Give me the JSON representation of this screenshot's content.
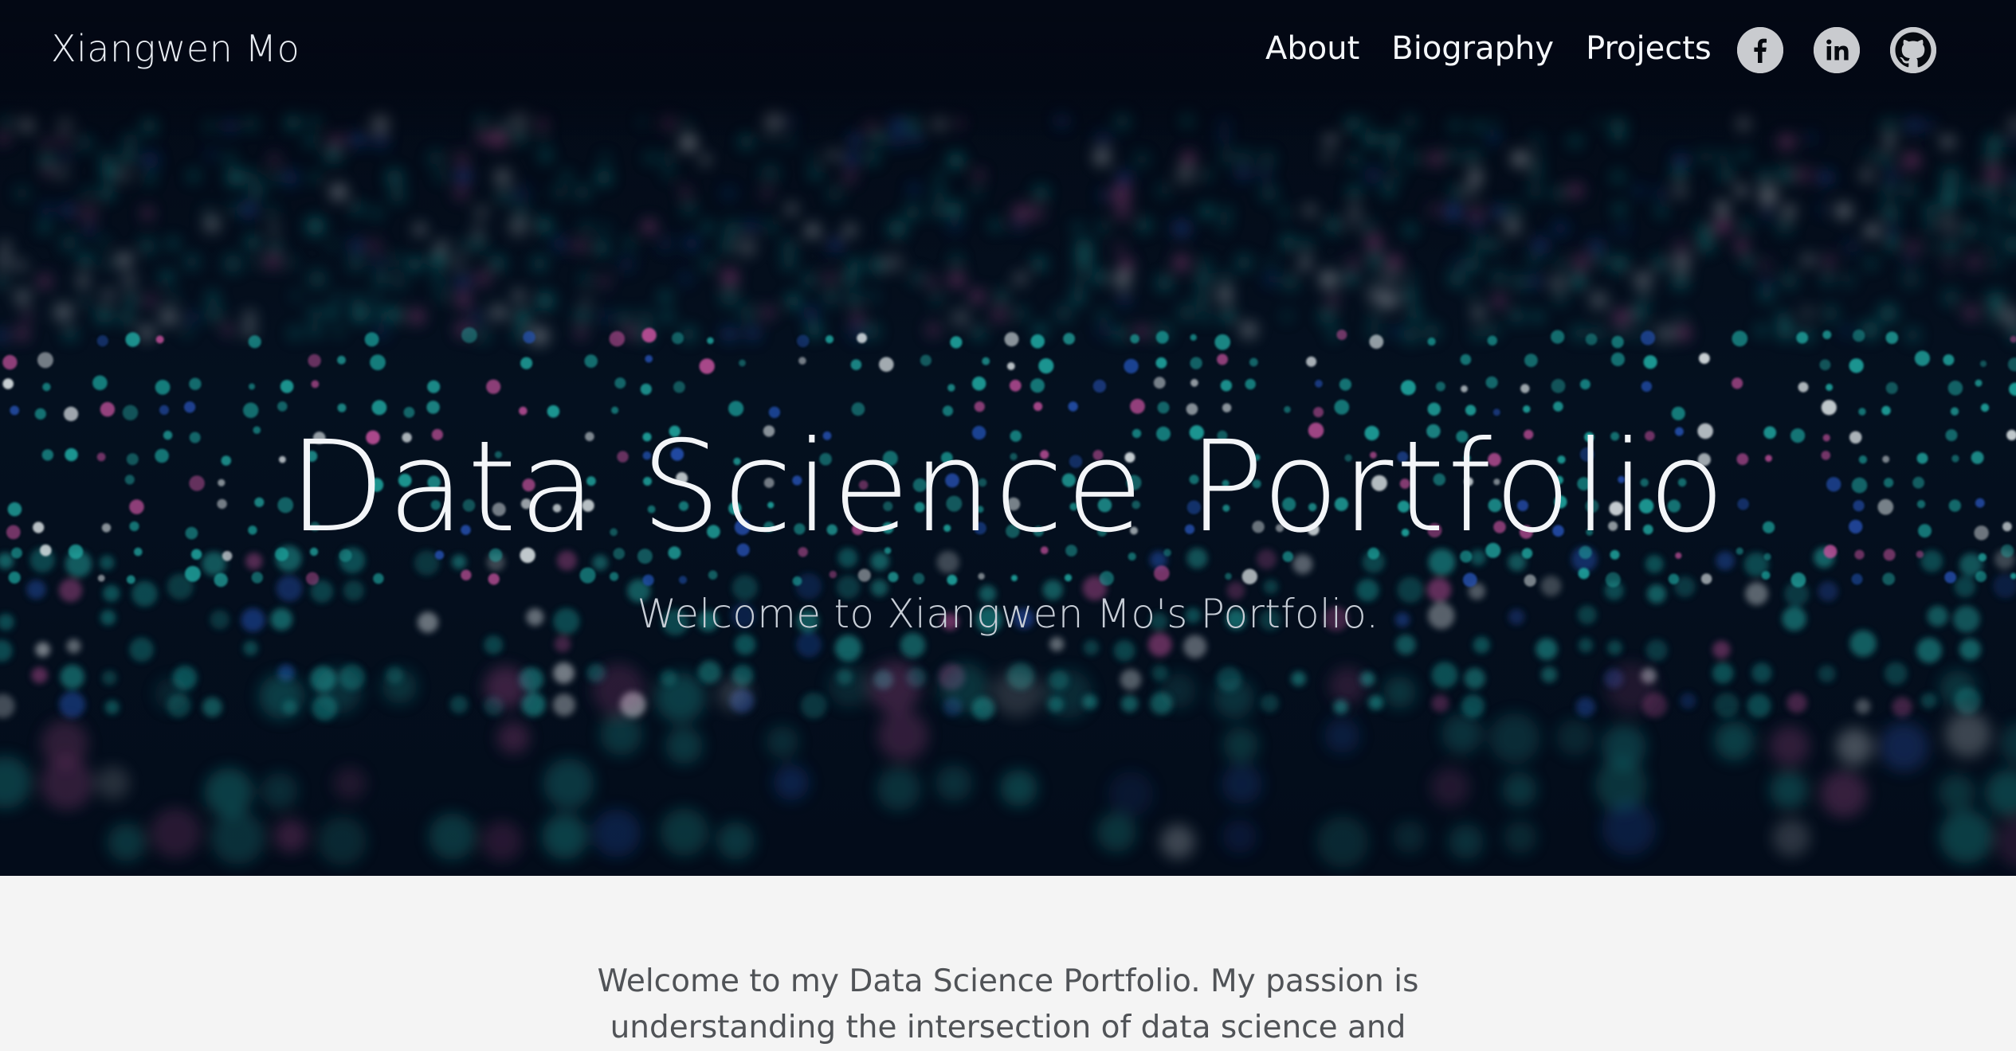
{
  "header": {
    "brand": "Xiangwen Mo",
    "nav": [
      "About",
      "Biography",
      "Projects"
    ],
    "social_icons": [
      "facebook-icon",
      "linkedin-icon",
      "github-icon"
    ]
  },
  "hero": {
    "title": "Data Science Portfolio",
    "subtitle": "Welcome to Xiangwen Mo's Portfolio."
  },
  "intro": {
    "text": "Welcome to my Data Science Portfolio. My passion is understanding the intersection of data science and"
  },
  "colors": {
    "hero_bg": "#030c1a",
    "dot_teal": "#1fa6a0",
    "dot_pink": "#c2509b",
    "dot_blue": "#2450b0",
    "dot_white": "#dfe6e9",
    "intro_bg": "#f4f4f4",
    "icon_bg": "#c9cbcf"
  }
}
